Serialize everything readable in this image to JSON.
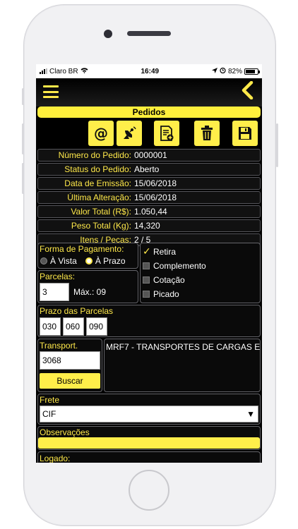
{
  "status": {
    "carrier": "Claro BR",
    "time": "16:49",
    "battery": "82%"
  },
  "header": {
    "title": "Pedidos"
  },
  "order": [
    {
      "label": "Número do Pedido:",
      "value": "0000001"
    },
    {
      "label": "Status do Pedido:",
      "value": "Aberto"
    },
    {
      "label": "Data de Emissão:",
      "value": "15/06/2018"
    },
    {
      "label": "Última Alteração:",
      "value": "15/06/2018"
    },
    {
      "label": "Valor Total (R$):",
      "value": "1.050,44"
    },
    {
      "label": "Peso Total (Kg):",
      "value": "14,320"
    },
    {
      "label": "Itens / Peças:",
      "value": "2 / 5"
    }
  ],
  "payment": {
    "label": "Forma de Pagamento:",
    "option_cash": "À Vista",
    "option_term": "À Prazo",
    "selected": "À Prazo"
  },
  "parcelas": {
    "label": "Parcelas:",
    "value": "3",
    "max_label": "Máx.: 09"
  },
  "options": {
    "retira": "Retira",
    "complemento": "Complemento",
    "cotacao": "Cotação",
    "picado": "Picado",
    "checked": "Retira"
  },
  "prazo": {
    "label": "Prazo das Parcelas",
    "values": [
      "030",
      "060",
      "090"
    ]
  },
  "transport": {
    "label": "Transport.",
    "code": "3068",
    "name": "MRF7 - TRANSPORTES DE CARGAS E",
    "search_label": "Buscar"
  },
  "frete": {
    "label": "Frete",
    "value": "CIF",
    "arrow": "▼"
  },
  "observacoes": {
    "label": "Observações",
    "value": ""
  },
  "footer": {
    "logado": "Logado:"
  },
  "colors": {
    "accent": "#ffee4a",
    "background": "#000000"
  }
}
